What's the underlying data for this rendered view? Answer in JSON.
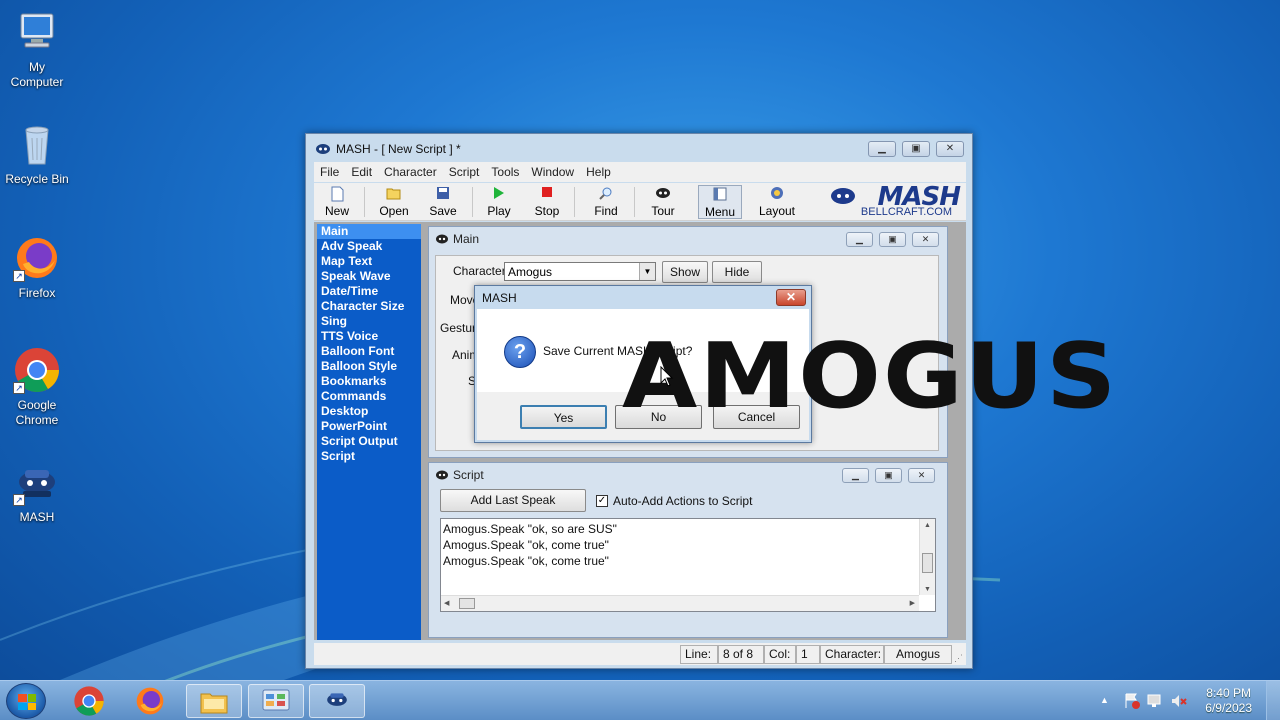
{
  "desktop_icons": [
    {
      "label_1": "My",
      "label_2": "Computer",
      "icon": "computer-icon"
    },
    {
      "label_1": "Recycle Bin",
      "icon": "recycle-bin-icon"
    },
    {
      "label_1": "Firefox",
      "icon": "firefox-icon"
    },
    {
      "label_1": "Google",
      "label_2": "Chrome",
      "icon": "chrome-icon"
    },
    {
      "label_1": "MASH",
      "icon": "mash-icon"
    }
  ],
  "window": {
    "title": "MASH - [ New Script ] *",
    "menu": [
      "File",
      "Edit",
      "Character",
      "Script",
      "Tools",
      "Window",
      "Help"
    ],
    "toolbar": [
      "New",
      "Open",
      "Save",
      "Play",
      "Stop",
      "Find",
      "Tour",
      "Menu",
      "Layout"
    ],
    "logo_text": "MASH",
    "logo_url": "BELLCRAFT.COM"
  },
  "sidebar": {
    "selected": "Main",
    "items": [
      "Main",
      "Adv Speak",
      "Map Text",
      "Speak Wave",
      "Date/Time",
      "Character Size",
      "Sing",
      "TTS Voice",
      "Balloon Font",
      "Balloon Style",
      "Bookmarks",
      "Commands",
      "Desktop",
      "PowerPoint",
      "Script Output",
      "Script"
    ]
  },
  "main_panel": {
    "title": "Main",
    "character_label": "Character",
    "character_value": "Amogus",
    "show_label": "Show",
    "hide_label": "Hide",
    "move_label": "Move",
    "gesture_label": "Gesture",
    "anim_label": "Anim",
    "s_label": "S"
  },
  "script_panel": {
    "title": "Script",
    "add_last_speak": "Add Last Speak",
    "auto_add_label": "Auto-Add Actions to Script",
    "auto_add_checked": true,
    "lines": [
      "Amogus.Speak \"ok, so are SUS\"",
      "Amogus.Speak \"ok, come true\"",
      "Amogus.Speak \"ok, come true\""
    ]
  },
  "status": {
    "line_label": "Line:",
    "line_value": "8 of 8",
    "col_label": "Col:",
    "col_value": "1",
    "char_label": "Character:",
    "char_value": "Amogus"
  },
  "dialog": {
    "title": "MASH",
    "message": "Save Current MASH Script?",
    "yes": "Yes",
    "no": "No",
    "cancel": "Cancel"
  },
  "overlay_text": "AMOGUS",
  "taskbar": {
    "time": "8:40 PM",
    "date": "6/9/2023",
    "pinned": [
      "chrome-icon",
      "firefox-icon",
      "file-explorer-icon",
      "control-panel-icon",
      "mash-icon"
    ]
  },
  "colors": {
    "sidebar_bg": "#0b5cc8",
    "sidebar_selected": "#3d8ff0",
    "desktop_bg": "#1e78d2"
  }
}
